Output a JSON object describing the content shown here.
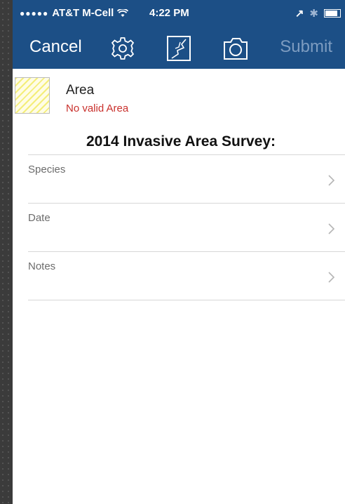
{
  "status_bar": {
    "signal": "●●●●●",
    "carrier": "AT&T M-Cell",
    "wifi": "wifi-icon",
    "time": "4:22 PM",
    "location_glyph": "↗",
    "bluetooth_glyph": "✱"
  },
  "nav": {
    "cancel_label": "Cancel",
    "submit_label": "Submit",
    "icons": [
      "gear-icon",
      "map-sketch-icon",
      "camera-icon"
    ]
  },
  "area": {
    "title": "Area",
    "status": "No valid Area"
  },
  "survey_title": "2014 Invasive Area Survey:",
  "fields": [
    {
      "label": "Species"
    },
    {
      "label": "Date"
    },
    {
      "label": "Notes"
    }
  ],
  "colors": {
    "nav_bg": "#1c4f86",
    "error_text": "#c9302c",
    "submit_disabled": "#7d9cc0",
    "area_hatch": "#f4ee7a"
  }
}
